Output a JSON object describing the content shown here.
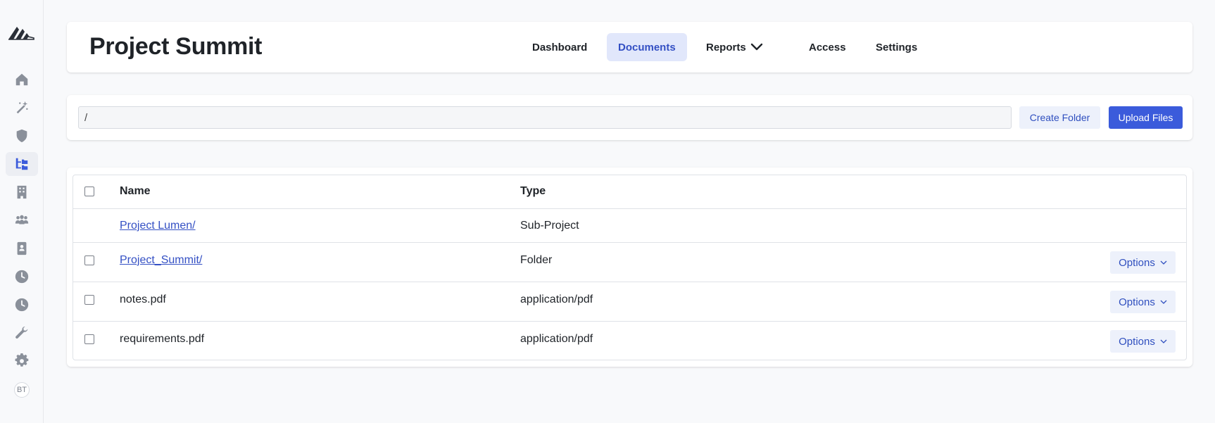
{
  "sidebar": {
    "items": [
      {
        "name": "home-icon"
      },
      {
        "name": "magic-wand-icon"
      },
      {
        "name": "shield-icon"
      },
      {
        "name": "folder-tree-icon",
        "active": true
      },
      {
        "name": "building-icon"
      },
      {
        "name": "people-group-icon"
      },
      {
        "name": "contact-book-icon"
      },
      {
        "name": "clock-icon"
      },
      {
        "name": "history-clock-icon"
      },
      {
        "name": "wrench-icon"
      },
      {
        "name": "gear-icon"
      }
    ],
    "avatar_initials": "BT"
  },
  "header": {
    "title": "Project Summit",
    "tabs": [
      {
        "label": "Dashboard",
        "active": false
      },
      {
        "label": "Documents",
        "active": true
      },
      {
        "label": "Reports",
        "active": false,
        "dropdown": true
      },
      {
        "label": "Access",
        "active": false
      },
      {
        "label": "Settings",
        "active": false
      }
    ]
  },
  "toolbar": {
    "path_value": "/",
    "create_folder_label": "Create Folder",
    "upload_files_label": "Upload Files"
  },
  "table": {
    "columns": [
      "Name",
      "Type"
    ],
    "rows": [
      {
        "name": "Project Lumen/",
        "type": "Sub-Project",
        "link": true,
        "checkbox": false,
        "options": false
      },
      {
        "name": "Project_Summit/",
        "type": "Folder",
        "link": true,
        "checkbox": true,
        "options": true
      },
      {
        "name": "notes.pdf",
        "type": "application/pdf",
        "link": false,
        "checkbox": true,
        "options": true
      },
      {
        "name": "requirements.pdf",
        "type": "application/pdf",
        "link": false,
        "checkbox": true,
        "options": true
      }
    ],
    "options_label": "Options"
  },
  "colors": {
    "accent": "#3b5bdb",
    "link": "#3450c4",
    "active_tab_bg": "#e1e7fb",
    "icon_default": "#8a909a",
    "icon_active": "#3b5bdb"
  }
}
